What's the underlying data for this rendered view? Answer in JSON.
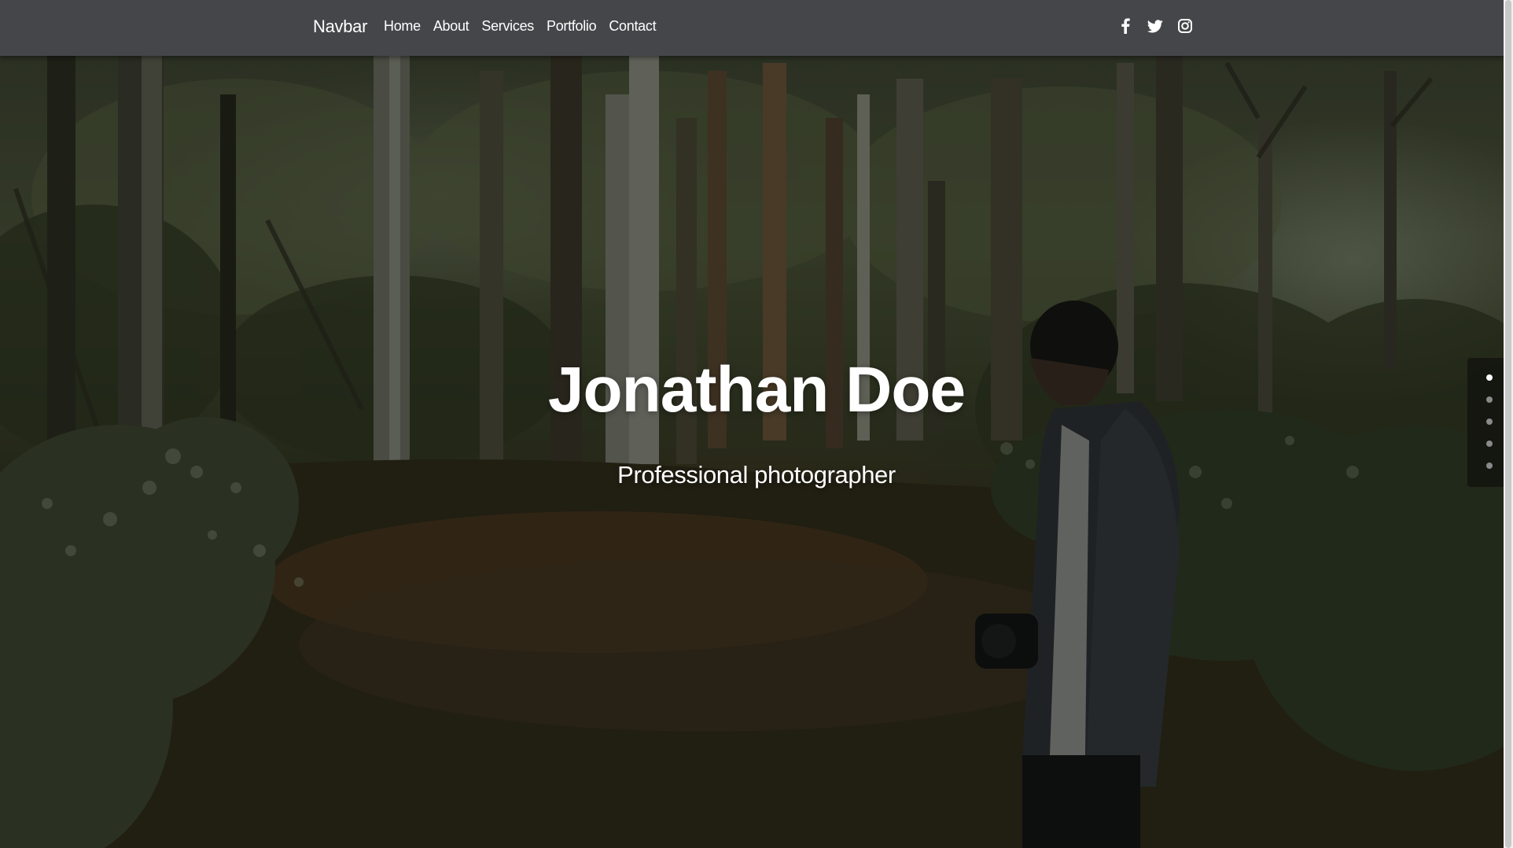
{
  "navbar": {
    "brand": "Navbar",
    "links": [
      {
        "label": "Home"
      },
      {
        "label": "About"
      },
      {
        "label": "Services"
      },
      {
        "label": "Portfolio"
      },
      {
        "label": "Contact"
      }
    ],
    "social_icons": [
      "facebook-icon",
      "twitter-icon",
      "instagram-icon"
    ],
    "background_color": "#454649"
  },
  "hero": {
    "title": "Jonathan Doe",
    "subtitle": "Professional photographer"
  },
  "slider": {
    "dot_count": 5,
    "active_index": 0
  }
}
